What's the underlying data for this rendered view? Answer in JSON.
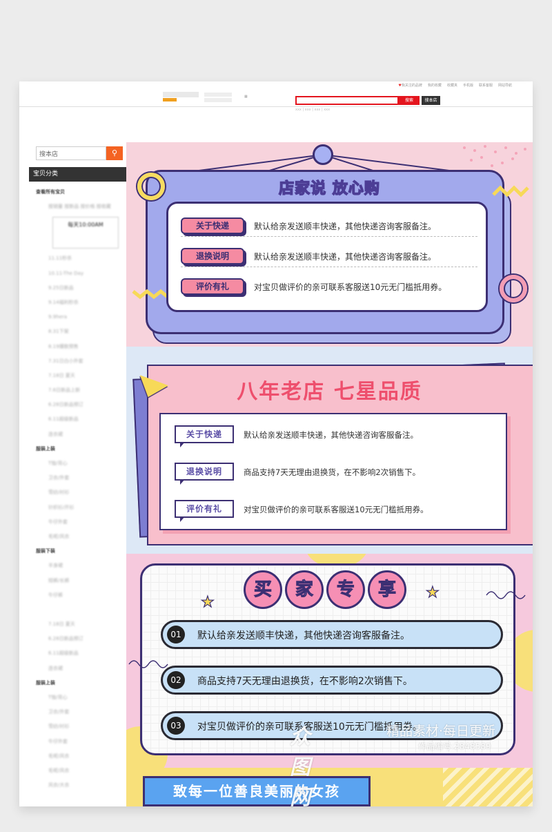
{
  "topbar": {
    "links": [
      "我关注的品牌",
      "我的收藏",
      "收藏夹",
      "手机版",
      "联系客服",
      "网站导航"
    ],
    "search_button": "搜索",
    "shop_search_button": "搜本店",
    "hotwords": "xxx | xxx | xxx | xxx"
  },
  "sidebar": {
    "search_placeholder": "搜本店",
    "category_header": "宝贝分类",
    "categories": [
      {
        "label": "查看所有宝贝",
        "group": true
      },
      {
        "label": "按销量 按新品 按价格 按收藏",
        "group": false
      },
      {
        "label": "",
        "promo": true,
        "promo_text": "每天10:00AM"
      },
      {
        "label": "11.11秒杀",
        "group": false
      },
      {
        "label": "10.11-The Day",
        "group": false
      },
      {
        "label": "9.25日新品",
        "group": false
      },
      {
        "label": "9.14福利秒杀",
        "group": false
      },
      {
        "label": "9.9hera",
        "group": false
      },
      {
        "label": "8.31下架",
        "group": false
      },
      {
        "label": "8.19爆款预售",
        "group": false
      },
      {
        "label": "7.31日白小外套",
        "group": false
      },
      {
        "label": "7.18日 夏天",
        "group": false
      },
      {
        "label": "7.6日新品上新",
        "group": false
      },
      {
        "label": "6.28日新品预订",
        "group": false
      },
      {
        "label": "6.11超级新品",
        "group": false
      },
      {
        "label": "连衣裙",
        "group": false
      },
      {
        "label": "服装上装",
        "group": true
      },
      {
        "label": "T恤/背心",
        "group": false
      },
      {
        "label": "卫衣/外套",
        "group": false
      },
      {
        "label": "雪纺/衬衫",
        "group": false
      },
      {
        "label": "针织衫/开衫",
        "group": false
      },
      {
        "label": "牛仔外套",
        "group": false
      },
      {
        "label": "毛呢/风衣",
        "group": false
      },
      {
        "label": "服装下装",
        "group": true
      },
      {
        "label": "半身裙",
        "group": false
      },
      {
        "label": "短裤/长裤",
        "group": false
      },
      {
        "label": "牛仔裤",
        "group": false
      },
      {
        "label": "",
        "group": false
      },
      {
        "label": "7.18日 夏天",
        "group": false
      },
      {
        "label": "6.28日新品预订",
        "group": false
      },
      {
        "label": "6.11超级新品",
        "group": false
      },
      {
        "label": "连衣裙",
        "group": false
      },
      {
        "label": "服装上装",
        "group": true
      },
      {
        "label": "T恤/背心",
        "group": false
      },
      {
        "label": "卫衣/外套",
        "group": false
      },
      {
        "label": "雪纺/衬衫",
        "group": false
      },
      {
        "label": "牛仔外套",
        "group": false
      },
      {
        "label": "毛呢/风衣",
        "group": false
      },
      {
        "label": "毛呢/风衣",
        "group": false
      },
      {
        "label": "风衣/大衣",
        "group": false
      }
    ]
  },
  "section1": {
    "title": "店家说 放心购",
    "rows": [
      {
        "tag": "关于快递",
        "text": "默认给亲发送顺丰快递，其他快递咨询客服备注。"
      },
      {
        "tag": "退换说明",
        "text": "默认给亲发送顺丰快递，其他快递咨询客服备注。"
      },
      {
        "tag": "评价有礼",
        "text": "对宝贝做评价的亲可联系客服送10元无门槛抵用券。"
      }
    ]
  },
  "section2": {
    "title": "八年老店 七星品质",
    "rows": [
      {
        "tag": "关于快递",
        "text": "默认给亲发送顺丰快递，其他快递咨询客服备注。"
      },
      {
        "tag": "退换说明",
        "text": "商品支持7天无理由退换货，在不影响2次销售下。"
      },
      {
        "tag": "评价有礼",
        "text": "对宝贝做评价的亲可联系客服送10元无门槛抵用券。"
      }
    ]
  },
  "section3": {
    "title_chars": [
      "买",
      "家",
      "专",
      "享"
    ],
    "rows": [
      {
        "num": "01",
        "text": "默认给亲发送顺丰快递，其他快递咨询客服备注。"
      },
      {
        "num": "02",
        "text": "商品支持7天无理由退换货，在不影响2次销售下。"
      },
      {
        "num": "03",
        "text": "对宝贝做评价的亲可联系客服送10元无门槛抵用券。"
      }
    ]
  },
  "section4": {
    "banner": "致每一位善良美丽的女孩"
  },
  "watermark": {
    "logo": "众图网",
    "slogan": "精品素材·每日更新",
    "code": "作品编号:2848589"
  },
  "colors": {
    "accent_red": "#e4151e",
    "search_orange": "#f46322",
    "navy": "#3c2f73",
    "pink": "#f58ba2",
    "lavender": "#a2a9ec",
    "yellow": "#f8e07a"
  }
}
